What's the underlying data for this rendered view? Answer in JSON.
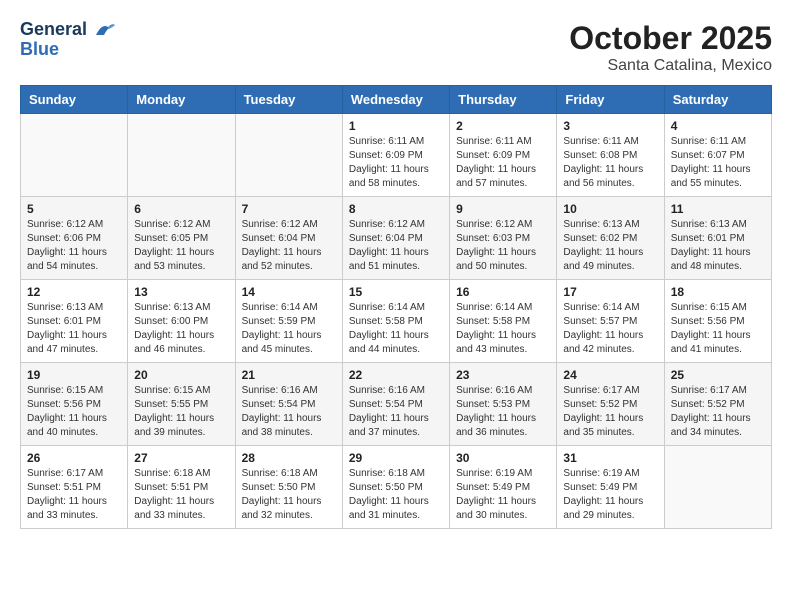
{
  "header": {
    "logo_line1": "General",
    "logo_line2": "Blue",
    "month": "October 2025",
    "location": "Santa Catalina, Mexico"
  },
  "weekdays": [
    "Sunday",
    "Monday",
    "Tuesday",
    "Wednesday",
    "Thursday",
    "Friday",
    "Saturday"
  ],
  "weeks": [
    [
      {
        "day": "",
        "info": ""
      },
      {
        "day": "",
        "info": ""
      },
      {
        "day": "",
        "info": ""
      },
      {
        "day": "1",
        "info": "Sunrise: 6:11 AM\nSunset: 6:09 PM\nDaylight: 11 hours\nand 58 minutes."
      },
      {
        "day": "2",
        "info": "Sunrise: 6:11 AM\nSunset: 6:09 PM\nDaylight: 11 hours\nand 57 minutes."
      },
      {
        "day": "3",
        "info": "Sunrise: 6:11 AM\nSunset: 6:08 PM\nDaylight: 11 hours\nand 56 minutes."
      },
      {
        "day": "4",
        "info": "Sunrise: 6:11 AM\nSunset: 6:07 PM\nDaylight: 11 hours\nand 55 minutes."
      }
    ],
    [
      {
        "day": "5",
        "info": "Sunrise: 6:12 AM\nSunset: 6:06 PM\nDaylight: 11 hours\nand 54 minutes."
      },
      {
        "day": "6",
        "info": "Sunrise: 6:12 AM\nSunset: 6:05 PM\nDaylight: 11 hours\nand 53 minutes."
      },
      {
        "day": "7",
        "info": "Sunrise: 6:12 AM\nSunset: 6:04 PM\nDaylight: 11 hours\nand 52 minutes."
      },
      {
        "day": "8",
        "info": "Sunrise: 6:12 AM\nSunset: 6:04 PM\nDaylight: 11 hours\nand 51 minutes."
      },
      {
        "day": "9",
        "info": "Sunrise: 6:12 AM\nSunset: 6:03 PM\nDaylight: 11 hours\nand 50 minutes."
      },
      {
        "day": "10",
        "info": "Sunrise: 6:13 AM\nSunset: 6:02 PM\nDaylight: 11 hours\nand 49 minutes."
      },
      {
        "day": "11",
        "info": "Sunrise: 6:13 AM\nSunset: 6:01 PM\nDaylight: 11 hours\nand 48 minutes."
      }
    ],
    [
      {
        "day": "12",
        "info": "Sunrise: 6:13 AM\nSunset: 6:01 PM\nDaylight: 11 hours\nand 47 minutes."
      },
      {
        "day": "13",
        "info": "Sunrise: 6:13 AM\nSunset: 6:00 PM\nDaylight: 11 hours\nand 46 minutes."
      },
      {
        "day": "14",
        "info": "Sunrise: 6:14 AM\nSunset: 5:59 PM\nDaylight: 11 hours\nand 45 minutes."
      },
      {
        "day": "15",
        "info": "Sunrise: 6:14 AM\nSunset: 5:58 PM\nDaylight: 11 hours\nand 44 minutes."
      },
      {
        "day": "16",
        "info": "Sunrise: 6:14 AM\nSunset: 5:58 PM\nDaylight: 11 hours\nand 43 minutes."
      },
      {
        "day": "17",
        "info": "Sunrise: 6:14 AM\nSunset: 5:57 PM\nDaylight: 11 hours\nand 42 minutes."
      },
      {
        "day": "18",
        "info": "Sunrise: 6:15 AM\nSunset: 5:56 PM\nDaylight: 11 hours\nand 41 minutes."
      }
    ],
    [
      {
        "day": "19",
        "info": "Sunrise: 6:15 AM\nSunset: 5:56 PM\nDaylight: 11 hours\nand 40 minutes."
      },
      {
        "day": "20",
        "info": "Sunrise: 6:15 AM\nSunset: 5:55 PM\nDaylight: 11 hours\nand 39 minutes."
      },
      {
        "day": "21",
        "info": "Sunrise: 6:16 AM\nSunset: 5:54 PM\nDaylight: 11 hours\nand 38 minutes."
      },
      {
        "day": "22",
        "info": "Sunrise: 6:16 AM\nSunset: 5:54 PM\nDaylight: 11 hours\nand 37 minutes."
      },
      {
        "day": "23",
        "info": "Sunrise: 6:16 AM\nSunset: 5:53 PM\nDaylight: 11 hours\nand 36 minutes."
      },
      {
        "day": "24",
        "info": "Sunrise: 6:17 AM\nSunset: 5:52 PM\nDaylight: 11 hours\nand 35 minutes."
      },
      {
        "day": "25",
        "info": "Sunrise: 6:17 AM\nSunset: 5:52 PM\nDaylight: 11 hours\nand 34 minutes."
      }
    ],
    [
      {
        "day": "26",
        "info": "Sunrise: 6:17 AM\nSunset: 5:51 PM\nDaylight: 11 hours\nand 33 minutes."
      },
      {
        "day": "27",
        "info": "Sunrise: 6:18 AM\nSunset: 5:51 PM\nDaylight: 11 hours\nand 33 minutes."
      },
      {
        "day": "28",
        "info": "Sunrise: 6:18 AM\nSunset: 5:50 PM\nDaylight: 11 hours\nand 32 minutes."
      },
      {
        "day": "29",
        "info": "Sunrise: 6:18 AM\nSunset: 5:50 PM\nDaylight: 11 hours\nand 31 minutes."
      },
      {
        "day": "30",
        "info": "Sunrise: 6:19 AM\nSunset: 5:49 PM\nDaylight: 11 hours\nand 30 minutes."
      },
      {
        "day": "31",
        "info": "Sunrise: 6:19 AM\nSunset: 5:49 PM\nDaylight: 11 hours\nand 29 minutes."
      },
      {
        "day": "",
        "info": ""
      }
    ]
  ]
}
